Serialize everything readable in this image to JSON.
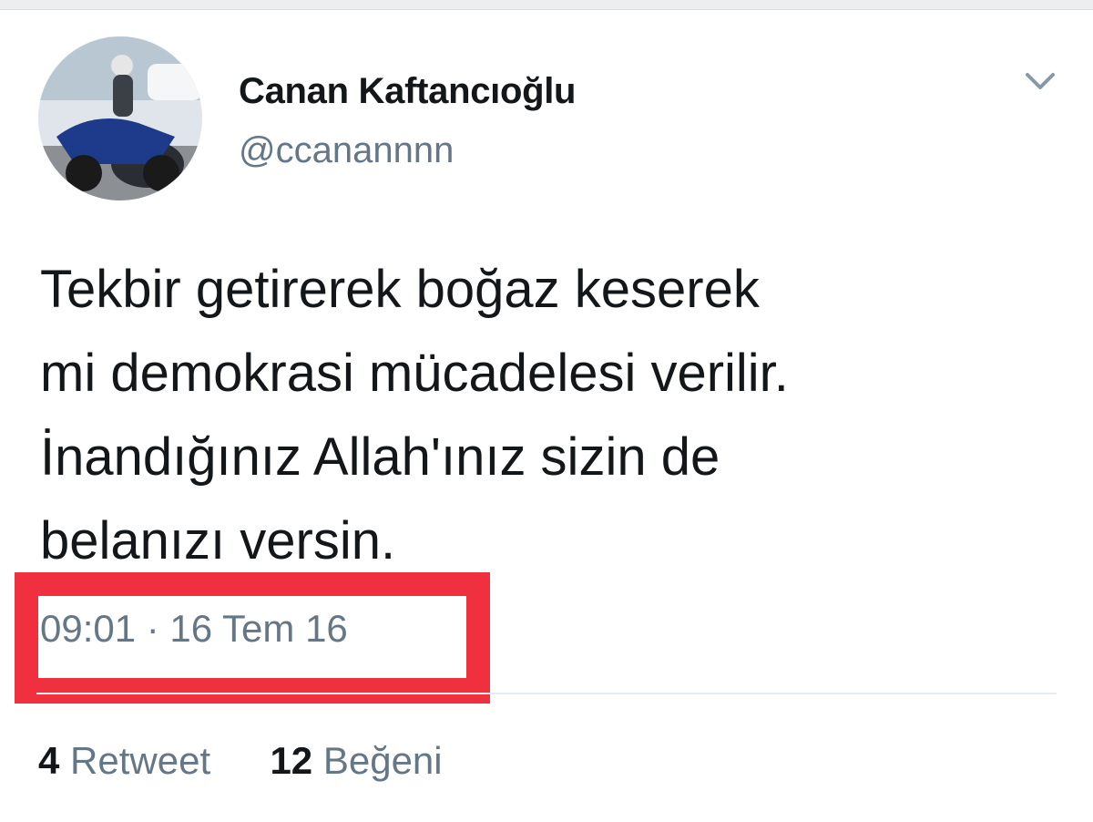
{
  "tweet": {
    "author": {
      "display_name": "Canan Kaftancıoğlu",
      "handle": "@ccanannnn",
      "avatar_icon": "avatar-motorcycle-photo"
    },
    "menu_icon": "chevron-down-icon",
    "text_lines": [
      "Tekbir getirerek boğaz keserek",
      "mi demokrasi mücadelesi verilir.",
      "İnandığınız Allah'ınız sizin de",
      "belanızı versin."
    ],
    "timestamp": "09:01 · 16 Tem 16",
    "highlight_color": "#f0303f",
    "stats": {
      "retweets_count": "4",
      "retweets_label": "Retweet",
      "likes_count": "12",
      "likes_label": "Beğeni"
    }
  },
  "colors": {
    "text_primary": "#14171a",
    "text_secondary": "#657786",
    "divider": "#e6ecf0"
  }
}
